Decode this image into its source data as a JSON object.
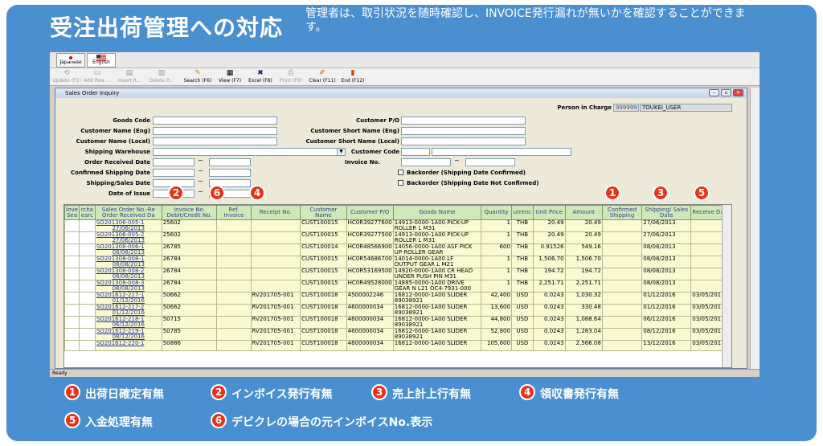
{
  "slide": {
    "title": "受注出荷管理への対応",
    "subtitle": "管理者は、取引状況を随時確認し、INVOICE発行漏れが無いかを確認することができます。"
  },
  "app": {
    "lang_japanese": "Japanese",
    "lang_english": "English",
    "toolbar": [
      {
        "label": "Update (F1)",
        "icon": "update-icon",
        "enabled": false
      },
      {
        "label": "Add Row ...",
        "icon": "add-row-icon",
        "enabled": false
      },
      {
        "label": "Insert R...",
        "icon": "insert-row-icon",
        "enabled": false
      },
      {
        "label": "Delete R...",
        "icon": "delete-row-icon",
        "enabled": false
      },
      {
        "label": "Search (F6)",
        "icon": "search-icon",
        "enabled": true
      },
      {
        "label": "View (F7)",
        "icon": "view-icon",
        "enabled": true
      },
      {
        "label": "Excel (F8)",
        "icon": "excel-icon",
        "enabled": true
      },
      {
        "label": "Print (F9)",
        "icon": "print-icon",
        "enabled": false
      },
      {
        "label": "Clear (F11)",
        "icon": "clear-icon",
        "enabled": true
      },
      {
        "label": "End (F12)",
        "icon": "end-icon",
        "enabled": true
      }
    ],
    "window_title": "Sales Order Inquiry",
    "person_label": "Person in Charge",
    "person_code": "999999",
    "person_name": "TOUKEI_USER",
    "form": {
      "goods_code": "Goods Code",
      "cust_name_eng": "Customer Name (Eng)",
      "cust_name_local": "Customer Name (Local)",
      "shipping_warehouse": "Shipping Warehouse",
      "order_received_date": "Order Received Date",
      "confirmed_shipping_date": "Confirmed Shipping Date",
      "shipping_sales_date": "Shipping/Sales Date",
      "date_of_issue": "Date of Issue",
      "customer_po": "Customer P/O",
      "cust_short_eng": "Customer Short Name (Eng)",
      "cust_short_local": "Customer Short Name (Local)",
      "customer_code": "Customer Code",
      "invoice_no": "Invoice No.",
      "backorder_confirmed": "Backorder (Shipping Date Confirmed)",
      "backorder_not_confirmed": "Backorder (Shipping Date Not Confirmed)",
      "tilde": "~"
    },
    "columns": [
      "Inve Sea",
      "rcha earc",
      "Sales Order No.-Re Order Received Da",
      "Invoice No. Debit/Credit No.",
      "Ref. Invoice",
      "Receipt No.",
      "Customer Name",
      "Customer P/O",
      "Goods Name",
      "Quantity",
      "urrenc",
      "Unit Price",
      "Amount",
      "Confirmed Shipping",
      "Shipping/ Sales Date",
      "Receive Date"
    ],
    "rows": [
      {
        "so": "SO201306-005-1",
        "date": "27/06/2013",
        "inv": "25602",
        "ref": "",
        "receipt": "",
        "cust": "CUST100015",
        "po": "HC0R39277600",
        "goods": "14913-0000-1A00 PICK-UP",
        "goods2": "ROLLER L M31",
        "qty": "1",
        "cur": "THB",
        "price": "20.49",
        "amt": "20.49",
        "conf": "",
        "ship": "27/06/2013",
        "recv": ""
      },
      {
        "so": "SO201306-005-2",
        "date": "27/06/2013",
        "inv": "25602",
        "ref": "",
        "receipt": "",
        "cust": "CUST100015",
        "po": "HC0R39277500",
        "goods": "14913-0000-1A00 PICK-UP",
        "goods2": "ROLLER L M31",
        "qty": "1",
        "cur": "THB",
        "price": "20.49",
        "amt": "20.49",
        "conf": "",
        "ship": "27/06/2013",
        "recv": ""
      },
      {
        "so": "SO201308-006-1",
        "date": "08/08/2013",
        "inv": "26785",
        "ref": "",
        "receipt": "",
        "cust": "CUST100014",
        "po": "HC0R48566900",
        "goods": "14056-0000-1A00 ASF PICK",
        "goods2": "UP ROLLER GEAR",
        "qty": "600",
        "cur": "THB",
        "price": "0.91526",
        "amt": "549.16",
        "conf": "",
        "ship": "08/08/2013",
        "recv": ""
      },
      {
        "so": "SO201308-008-1",
        "date": "08/08/2013",
        "inv": "26784",
        "ref": "",
        "receipt": "",
        "cust": "CUST100015",
        "po": "HC0R54686700",
        "goods": "14014-0000-1A00 LF",
        "goods2": "OUTPUT GEAR L M21",
        "qty": "1",
        "cur": "THB",
        "price": "1,506.70",
        "amt": "1,506.70",
        "conf": "",
        "ship": "08/08/2013",
        "recv": ""
      },
      {
        "so": "SO201308-008-2",
        "date": "08/08/2013",
        "inv": "26784",
        "ref": "",
        "receipt": "",
        "cust": "CUST100015",
        "po": "HC0R53169500",
        "goods": "14920-0000-1A00 CR HEAD",
        "goods2": "UNDER PUSH PIN M31",
        "qty": "1",
        "cur": "THB",
        "price": "194.72",
        "amt": "194.72",
        "conf": "",
        "ship": "08/08/2013",
        "recv": ""
      },
      {
        "so": "SO201308-008-3",
        "date": "08/08/2013",
        "inv": "26784",
        "ref": "",
        "receipt": "",
        "cust": "CUST100015",
        "po": "HC0R49528000",
        "goods": "14885-0000-1A00 DRIVE",
        "goods2": "GEAR N L21 OC4-7931-000",
        "qty": "1",
        "cur": "THB",
        "price": "2,251.71",
        "amt": "2,251.71",
        "conf": "",
        "ship": "08/08/2013",
        "recv": ""
      },
      {
        "so": "SO201612-217-1",
        "date": "01/12/2016",
        "inv": "50662",
        "ref": "",
        "receipt": "RV201705-001",
        "cust": "CUST100018",
        "po": "4500002246",
        "goods": "16812-0000-1A00 SLIDER",
        "goods2": "89038921",
        "qty": "42,400",
        "cur": "USD",
        "price": "0.0243",
        "amt": "1,030.32",
        "conf": "",
        "ship": "01/12/2016",
        "recv": "03/05/2017"
      },
      {
        "so": "SO201612-217-2",
        "date": "01/12/2016",
        "inv": "50662",
        "ref": "",
        "receipt": "RV201705-001",
        "cust": "CUST100018",
        "po": "4600000034",
        "goods": "16812-0000-1A00 SLIDER",
        "goods2": "89038921",
        "qty": "13,600",
        "cur": "USD",
        "price": "0.0243",
        "amt": "330.48",
        "conf": "",
        "ship": "01/12/2016",
        "recv": "03/05/2017"
      },
      {
        "so": "SO201612-218-1",
        "date": "06/12/2016",
        "inv": "50715",
        "ref": "",
        "receipt": "RV201705-001",
        "cust": "CUST100018",
        "po": "4600000034",
        "goods": "16812-0000-1A00 SLIDER",
        "goods2": "89038921",
        "qty": "44,800",
        "cur": "USD",
        "price": "0.0243",
        "amt": "1,088.64",
        "conf": "",
        "ship": "06/12/2016",
        "recv": "03/05/2017"
      },
      {
        "so": "SO201612-219-1",
        "date": "08/12/2016",
        "inv": "50785",
        "ref": "",
        "receipt": "RV201705-001",
        "cust": "CUST100018",
        "po": "4600000034",
        "goods": "16812-0000-1A00 SLIDER",
        "goods2": "89038921",
        "qty": "52,800",
        "cur": "USD",
        "price": "0.0243",
        "amt": "1,283.04",
        "conf": "",
        "ship": "08/12/2016",
        "recv": "03/05/2017"
      },
      {
        "so": "SO201612-220-1",
        "date": "",
        "inv": "50886",
        "ref": "",
        "receipt": "RV201705-001",
        "cust": "CUST100018",
        "po": "4600000034",
        "goods": "16812-0000-1A00 SLIDER",
        "goods2": "",
        "qty": "105,600",
        "cur": "USD",
        "price": "0.0243",
        "amt": "2,566.08",
        "conf": "",
        "ship": "13/12/2016",
        "recv": "03/05/2017"
      }
    ],
    "status": "Ready"
  },
  "markers": {
    "n1": "1",
    "n2": "2",
    "n3": "3",
    "n4": "4",
    "n5": "5",
    "n6": "6"
  },
  "legend": {
    "l1": "出荷日確定有無",
    "l2": "インボイス発行有無",
    "l3": "売上計上行有無",
    "l4": "領収書発行有無",
    "l5": "入金処理有無",
    "l6": "デビクレの場合の元インボイスNo.表示"
  },
  "colors": {
    "slide_bg": "#4a8fd0",
    "marker": "#e8331a",
    "grid_header": "#cfe8b8",
    "grid_cell": "#fafad2"
  }
}
